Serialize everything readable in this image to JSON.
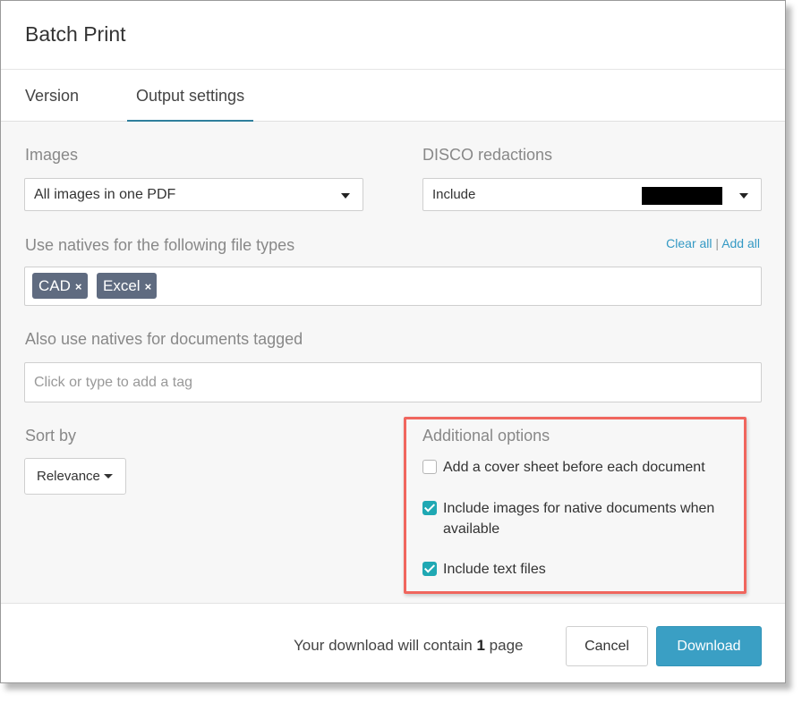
{
  "dialog": {
    "title": "Batch Print"
  },
  "tabs": [
    {
      "label": "Version",
      "active": false
    },
    {
      "label": "Output settings",
      "active": true
    }
  ],
  "images": {
    "label": "Images",
    "selected": "All images in one PDF"
  },
  "disco": {
    "label": "DISCO redactions",
    "selected": "Include"
  },
  "natives": {
    "label": "Use natives for the following file types",
    "clear_all": "Clear all",
    "separator": "|",
    "add_all": "Add all",
    "chips": [
      {
        "label": "CAD"
      },
      {
        "label": "Excel"
      }
    ],
    "chip_remove_glyph": "×"
  },
  "tagged": {
    "label": "Also use natives for documents tagged",
    "placeholder": "Click or type to add a tag"
  },
  "sort": {
    "label": "Sort by",
    "selected": "Relevance"
  },
  "additional": {
    "label": "Additional options",
    "options": [
      {
        "label": "Add a cover sheet before each document",
        "checked": false
      },
      {
        "label_line1": "Include images for native documents when",
        "label_line2": "available",
        "checked": true
      },
      {
        "label": "Include text files",
        "checked": true
      }
    ],
    "highlight_color": "#f0665e"
  },
  "footer": {
    "summary_prefix": "Your download will contain",
    "page_count": "1",
    "summary_suffix": "page",
    "cancel_label": "Cancel",
    "download_label": "Download"
  },
  "colors": {
    "accent": "#3a9fc4",
    "checkbox": "#1fa8b3",
    "chip": "#5f6b80",
    "tab_underline": "#2f7f9d"
  }
}
